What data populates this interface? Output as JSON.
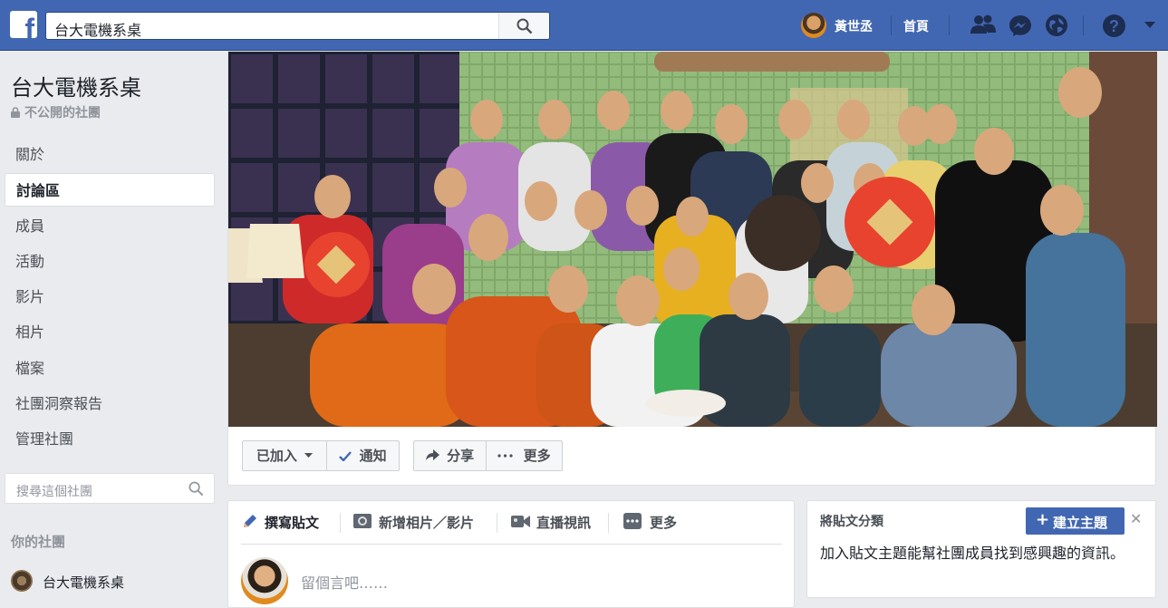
{
  "topbar": {
    "search_value": "台大電機系桌",
    "user_name": "黃世丞",
    "home_label": "首頁"
  },
  "sidebar": {
    "group_name": "台大電機系桌",
    "privacy": "不公開的社團",
    "items": [
      {
        "label": "關於"
      },
      {
        "label": "討論區",
        "active": true
      },
      {
        "label": "成員"
      },
      {
        "label": "活動"
      },
      {
        "label": "影片"
      },
      {
        "label": "相片"
      },
      {
        "label": "檔案"
      },
      {
        "label": "社團洞察報告"
      },
      {
        "label": "管理社團"
      }
    ],
    "search_placeholder": "搜尋這個社團",
    "your_groups_title": "你的社團",
    "your_groups": [
      {
        "label": "台大電機系桌"
      }
    ]
  },
  "cover": {
    "joined_label": "已加入",
    "notify_label": "通知",
    "share_label": "分享",
    "more_label": "更多"
  },
  "composer": {
    "tabs": [
      {
        "label": "撰寫貼文",
        "icon": "pencil-icon"
      },
      {
        "label": "新增相片／影片",
        "icon": "camera-icon"
      },
      {
        "label": "直播視訊",
        "icon": "video-camera-icon"
      },
      {
        "label": "更多",
        "icon": "more-icon"
      }
    ],
    "placeholder": "留個言吧……"
  },
  "topics": {
    "title": "將貼文分類",
    "create_label": "建立主題",
    "description": "加入貼文主題能幫社團成員找到感興趣的資訊。"
  },
  "colors": {
    "brand": "#4267b2",
    "background": "#e9ebee"
  }
}
